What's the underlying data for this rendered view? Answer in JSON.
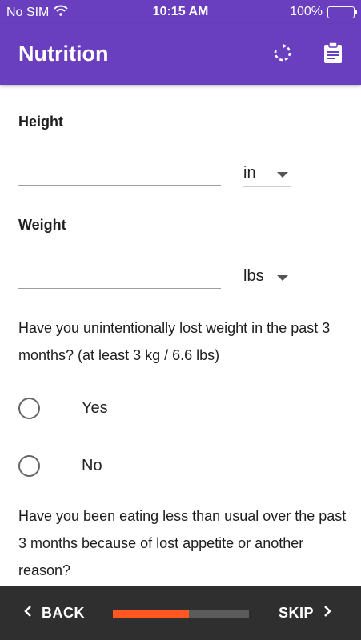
{
  "status_bar": {
    "carrier": "No SIM",
    "time": "10:15 AM",
    "battery": "100%"
  },
  "app_bar": {
    "title": "Nutrition",
    "icons": [
      "refresh-icon",
      "clipboard-icon"
    ]
  },
  "form": {
    "height": {
      "label": "Height",
      "value": "",
      "unit": "in"
    },
    "weight": {
      "label": "Weight",
      "value": "",
      "unit": "lbs"
    },
    "question1": {
      "text": "Have you unintentionally lost weight in the past 3 months? (at least 3 kg / 6.6 lbs)",
      "options": [
        "Yes",
        "No"
      ]
    },
    "question2": {
      "text": "Have you been eating less than usual over the past 3 months because of lost appetite or another reason?"
    }
  },
  "bottom_nav": {
    "back_label": "BACK",
    "skip_label": "SKIP",
    "progress_fraction": 0.56
  },
  "colors": {
    "primary": "#6a3fbf",
    "accent": "#ff5722",
    "bottom_bar": "#2f2f2f"
  }
}
